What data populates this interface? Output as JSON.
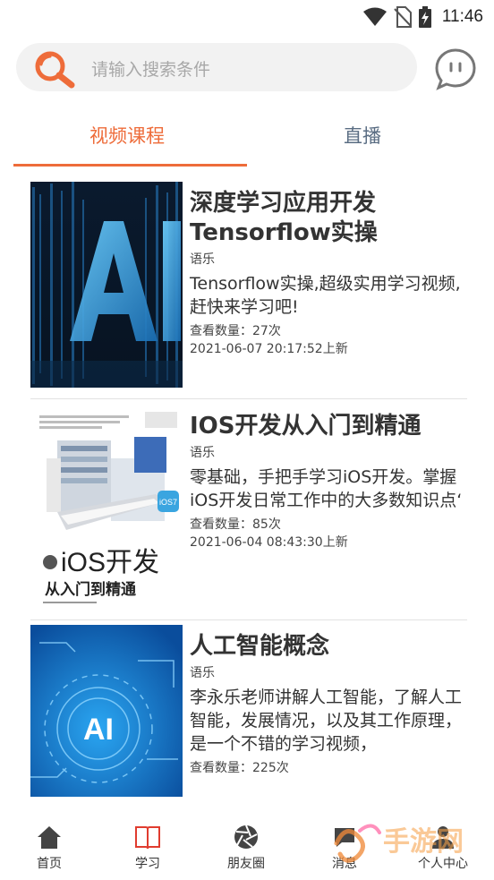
{
  "status": {
    "time": "11:46",
    "icons": [
      "wifi-icon",
      "no-sim-icon",
      "battery-charging-icon"
    ]
  },
  "search": {
    "placeholder": "请输入搜索条件",
    "icon": "search-icon",
    "chat_icon": "chat-bubble-icon"
  },
  "tabs": [
    {
      "label": "视频课程",
      "active": true
    },
    {
      "label": "直播",
      "active": false
    }
  ],
  "colors": {
    "accent": "#ee6c3a",
    "inactive_tab": "#5a6d83"
  },
  "courses": [
    {
      "title": "深度学习应用开发Tensorflow实操",
      "category": "语乐",
      "description": "Tensorflow实操,超级实用学习视频,赶快来学习吧!",
      "views": "查看数量：27次",
      "date": "2021-06-07 20:17:52上新",
      "thumb_text": "AI"
    },
    {
      "title": "IOS开发从入门到精通",
      "category": "语乐",
      "description": "零基础，手把手学习iOS开发。掌握iOS开发日常工作中的大多数知识点‘",
      "views": "查看数量：85次",
      "date": "2021-06-04 08:43:30上新",
      "thumb_title": "iOS开发",
      "thumb_subtitle": "从入门到精通",
      "thumb_badge": "iOS7"
    },
    {
      "title": "人工智能概念",
      "category": "语乐",
      "description": "李永乐老师讲解人工智能，了解人工智能，发展情况，以及其工作原理，是一个不错的学习视频，",
      "views": "查看数量：225次",
      "thumb_text": "AI"
    }
  ],
  "nav": [
    {
      "label": "首页",
      "icon": "home-icon"
    },
    {
      "label": "学习",
      "icon": "book-icon"
    },
    {
      "label": "朋友圈",
      "icon": "aperture-icon"
    },
    {
      "label": "消息",
      "icon": "message-icon"
    },
    {
      "label": "个人中心",
      "icon": "person-icon"
    }
  ],
  "watermark": "手游网"
}
